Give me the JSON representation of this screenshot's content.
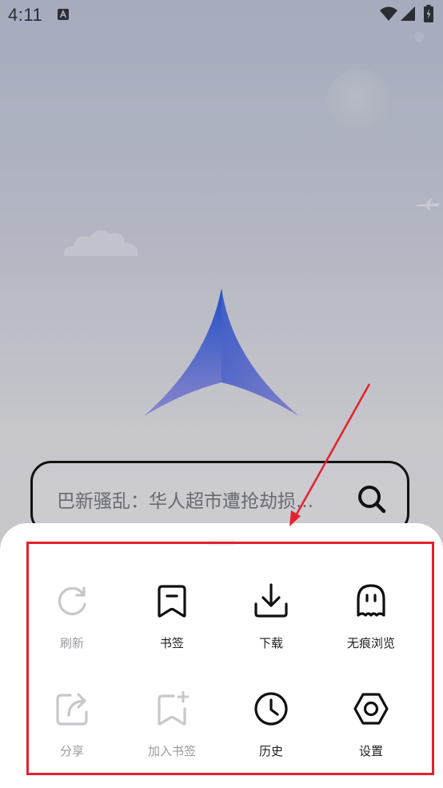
{
  "status_bar": {
    "time": "4:11"
  },
  "search": {
    "placeholder": "巴新骚乱：华人超市遭抢劫损..."
  },
  "menu": {
    "row1": [
      {
        "label": "刷新",
        "icon": "refresh-icon",
        "enabled": false
      },
      {
        "label": "书签",
        "icon": "bookmark-icon",
        "enabled": true
      },
      {
        "label": "下载",
        "icon": "download-icon",
        "enabled": true
      },
      {
        "label": "无痕浏览",
        "icon": "ghost-icon",
        "enabled": true
      }
    ],
    "row2": [
      {
        "label": "分享",
        "icon": "share-icon",
        "enabled": false
      },
      {
        "label": "加入书签",
        "icon": "add-bookmark-icon",
        "enabled": false
      },
      {
        "label": "历史",
        "icon": "history-clock-icon",
        "enabled": true
      },
      {
        "label": "设置",
        "icon": "settings-hexagon-icon",
        "enabled": true
      }
    ]
  },
  "colors": {
    "annotation": "#e2232e",
    "logo_top": "#1f4fc4",
    "logo_bottom": "#8a86cc"
  }
}
